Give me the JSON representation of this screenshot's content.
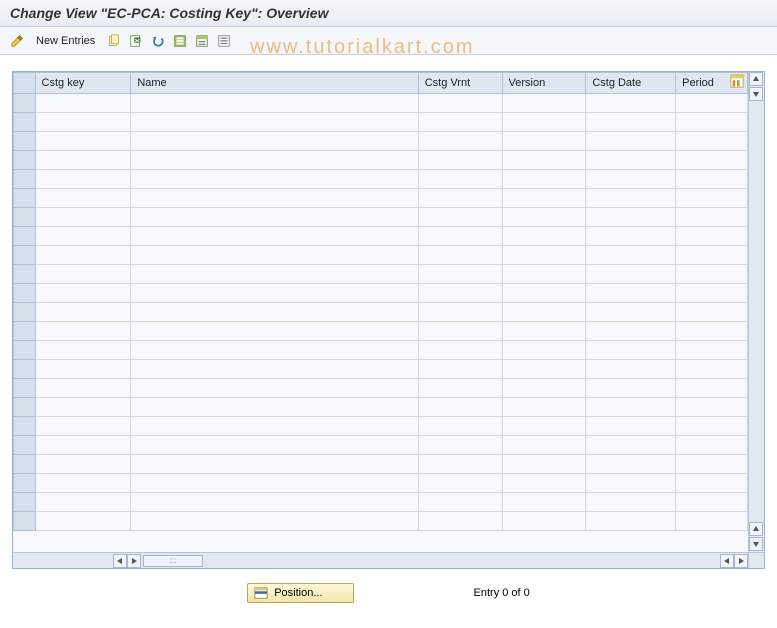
{
  "title": "Change View \"EC-PCA: Costing Key\": Overview",
  "toolbar": {
    "new_entries_label": "New Entries"
  },
  "watermark": "www.tutorialkart.com",
  "table": {
    "columns": [
      {
        "key": "cstg_key",
        "label": "Cstg key"
      },
      {
        "key": "name",
        "label": "Name"
      },
      {
        "key": "cstg_vrnt",
        "label": "Cstg Vrnt"
      },
      {
        "key": "version",
        "label": "Version"
      },
      {
        "key": "cstg_date",
        "label": "Cstg Date"
      },
      {
        "key": "period",
        "label": "Period"
      }
    ],
    "rows": [
      {},
      {},
      {},
      {},
      {},
      {},
      {},
      {},
      {},
      {},
      {},
      {},
      {},
      {},
      {},
      {},
      {},
      {},
      {},
      {},
      {},
      {},
      {}
    ]
  },
  "footer": {
    "position_label": "Position...",
    "entry_status": "Entry 0 of 0"
  },
  "icons": {
    "pencil": "pencil-icon",
    "copy": "copy-icon",
    "delete": "delete-icon",
    "undo": "undo-icon",
    "select_all": "select-all-icon",
    "select_block": "select-block-icon",
    "deselect": "deselect-icon",
    "table_config": "table-config-icon",
    "position": "position-icon"
  }
}
